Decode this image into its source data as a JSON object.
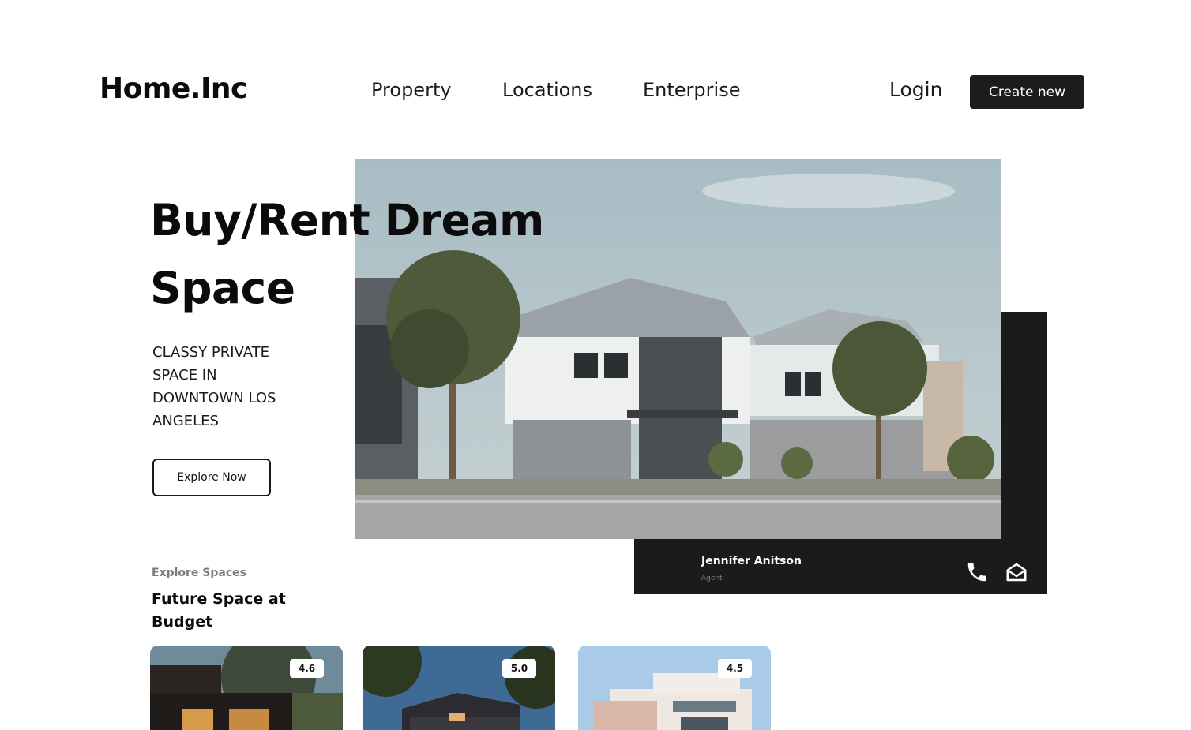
{
  "header": {
    "logo": "Home.Inc",
    "nav": [
      "Property",
      "Locations",
      "Enterprise"
    ],
    "login_label": "Login",
    "create_label": "Create new"
  },
  "hero": {
    "headline_line1": "Buy/Rent Dream",
    "headline_line2": "Space",
    "tagline": "CLASSY PRIVATE SPACE IN DOWNTOWN LOS ANGELES",
    "cta_label": "Explore Now"
  },
  "agent": {
    "name": "Jennifer Anitson",
    "role": "Agent",
    "phone_icon": "phone-icon",
    "mail_icon": "mail-open-icon"
  },
  "spaces": {
    "label": "Explore Spaces",
    "title": "Future Space at Budget",
    "cards": [
      {
        "rating": "4.6"
      },
      {
        "rating": "5.0"
      },
      {
        "rating": "4.5"
      }
    ]
  },
  "colors": {
    "dark": "#1b1b1b",
    "text": "#0b0b0b",
    "muted": "#7a7a7a"
  }
}
